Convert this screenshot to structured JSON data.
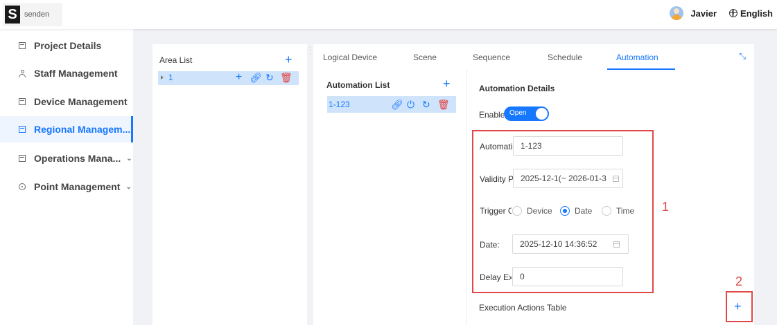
{
  "header": {
    "logo_text": "senden",
    "user_name": "Javier",
    "language": "English"
  },
  "sidebar": {
    "items": [
      {
        "label": "Project Details",
        "icon": "document-icon"
      },
      {
        "label": "Staff Management",
        "icon": "person-icon"
      },
      {
        "label": "Device Management",
        "icon": "device-icon"
      },
      {
        "label": "Regional Managem...",
        "icon": "grid-icon",
        "active": true
      },
      {
        "label": "Operations Mana...",
        "icon": "operations-icon",
        "chevron": "⌄"
      },
      {
        "label": "Point Management",
        "icon": "location-icon",
        "chevron": "⌄"
      }
    ]
  },
  "area_panel": {
    "title": "Area List",
    "add_icon": "+",
    "row_label": "1"
  },
  "tabs": [
    "Logical Device",
    "Scene",
    "Sequence",
    "Schedule",
    "Automation"
  ],
  "automation_list": {
    "title": "Automation List",
    "add_icon": "+",
    "row_label": "1-123"
  },
  "details": {
    "title": "Automation Details",
    "enable_label": "Enable Automation",
    "switch_text": "Open",
    "automation_name_label": "Automation Name",
    "automation_name_value": "1-123",
    "validity_label": "Validity Period",
    "validity_value": "2025-12-1(~ 2026-01-3",
    "trigger_label": "Trigger Condition",
    "trigger_options": [
      "Device",
      "Date",
      "Time"
    ],
    "trigger_selected": "Date",
    "date_label": "Date:",
    "date_value": "2025-12-10 14:36:52",
    "delay_label": "Delay Execution",
    "delay_value": "0",
    "exec_actions_title": "Execution Actions Table",
    "add_action_icon": "+"
  },
  "annotations": {
    "box1_number": "1",
    "box2_number": "2"
  },
  "colors": {
    "accent": "#1677ff",
    "annotation_red": "#e04848",
    "danger": "#e53935",
    "selected_row_bg": "#cfe3fb"
  }
}
